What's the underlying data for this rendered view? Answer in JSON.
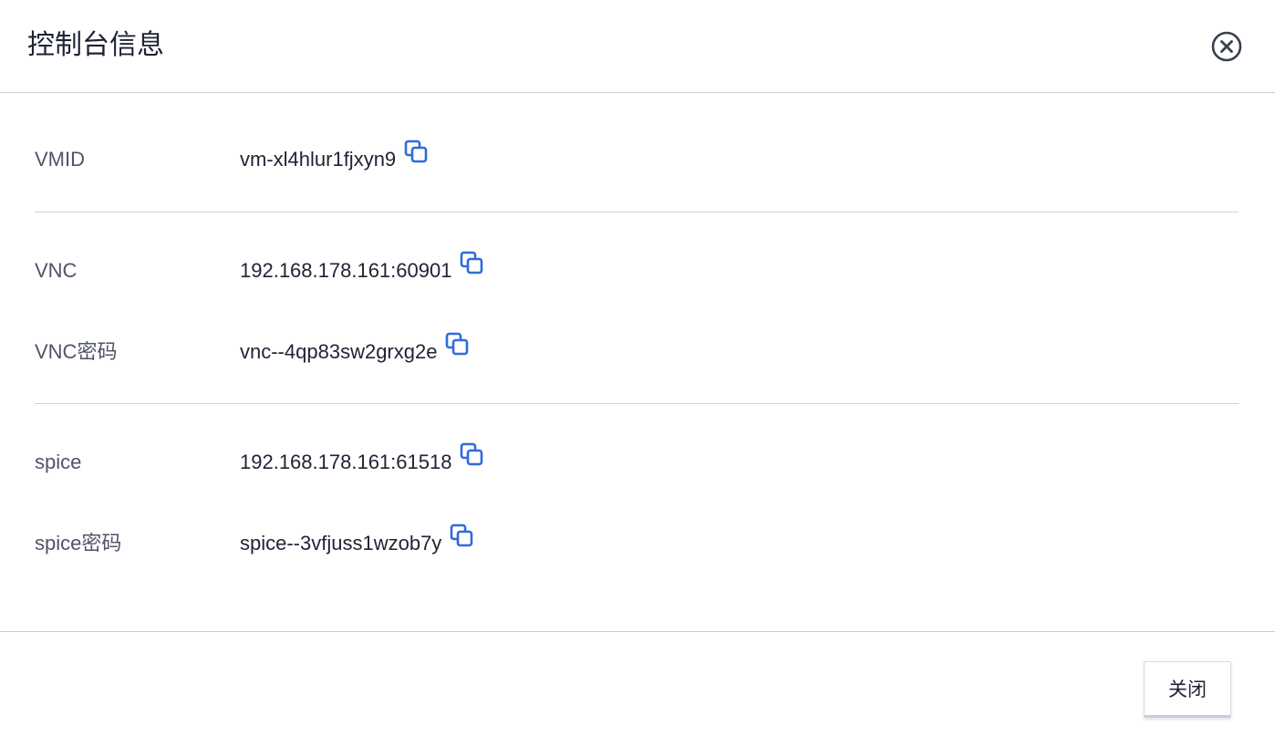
{
  "dialog": {
    "title": "控制台信息",
    "close_icon": "close-circle-icon"
  },
  "colors": {
    "accent": "#2f6bdc",
    "text_primary": "#1f2333",
    "text_label": "#4f5567",
    "divider": "#cfd3dd"
  },
  "rows": [
    {
      "label": "VMID",
      "value": "vm-xl4hlur1fjxyn9",
      "icon": "copy-icon"
    },
    {
      "label": "VNC",
      "value": "192.168.178.161:60901",
      "icon": "copy-icon"
    },
    {
      "label": "VNC密码",
      "value": "vnc--4qp83sw2grxg2e",
      "icon": "copy-icon"
    },
    {
      "label": "spice",
      "value": "192.168.178.161:61518",
      "icon": "copy-icon"
    },
    {
      "label": "spice密码",
      "value": "spice--3vfjuss1wzob7y",
      "icon": "copy-icon"
    }
  ],
  "footer": {
    "close_label": "关闭"
  }
}
